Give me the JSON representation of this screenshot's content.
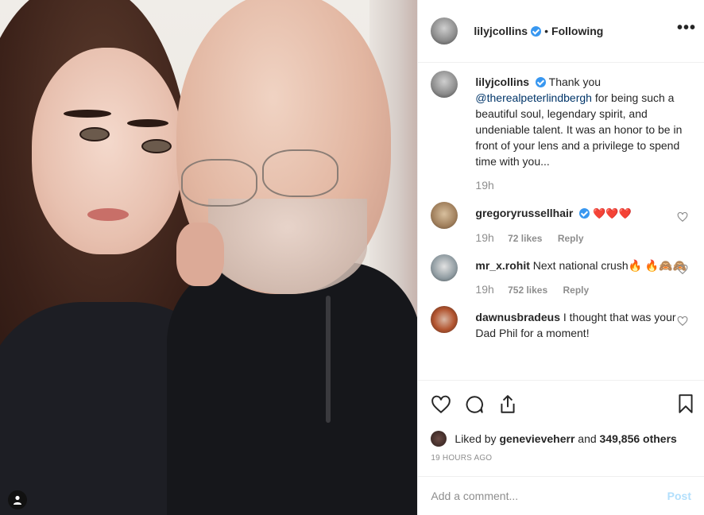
{
  "post": {
    "author": "lilyjcollins",
    "dot": "•",
    "follow_state": "Following",
    "more": "•••"
  },
  "caption": {
    "user": "lilyjcollins",
    "lead": "Thank you",
    "mention": "@therealpeterlindbergh",
    "rest": "for being such a beautiful soul, legendary spirit, and undeniable talent. It was an honor to be in front of your lens and a privilege to spend time with you...",
    "time": "19h"
  },
  "comments": [
    {
      "user": "gregoryrussellhair",
      "text": "❤️❤️❤️",
      "time": "19h",
      "likes": "72 likes",
      "reply": "Reply",
      "verified": true
    },
    {
      "user": "mr_x.rohit",
      "text": "Next national crush🔥 🔥🙈🙈",
      "time": "19h",
      "likes": "752 likes",
      "reply": "Reply",
      "verified": false
    },
    {
      "user": "dawnusbradeus",
      "text": "I thought that was your Dad Phil for a moment!",
      "verified": false
    }
  ],
  "likes_line": {
    "prefix": "Liked by",
    "user": "genevieveherr",
    "mid": "and",
    "count": "349,856 others"
  },
  "timestamp": "19 HOURS AGO",
  "add_comment": {
    "placeholder": "Add a comment...",
    "post": "Post"
  },
  "colors": {
    "verified": "#3897f0",
    "mention": "#003569",
    "post_disabled": "#b2dffc"
  },
  "icons": [
    "heart-icon",
    "comment-icon",
    "share-icon",
    "bookmark-icon",
    "user-tag-icon",
    "verified-icon"
  ]
}
